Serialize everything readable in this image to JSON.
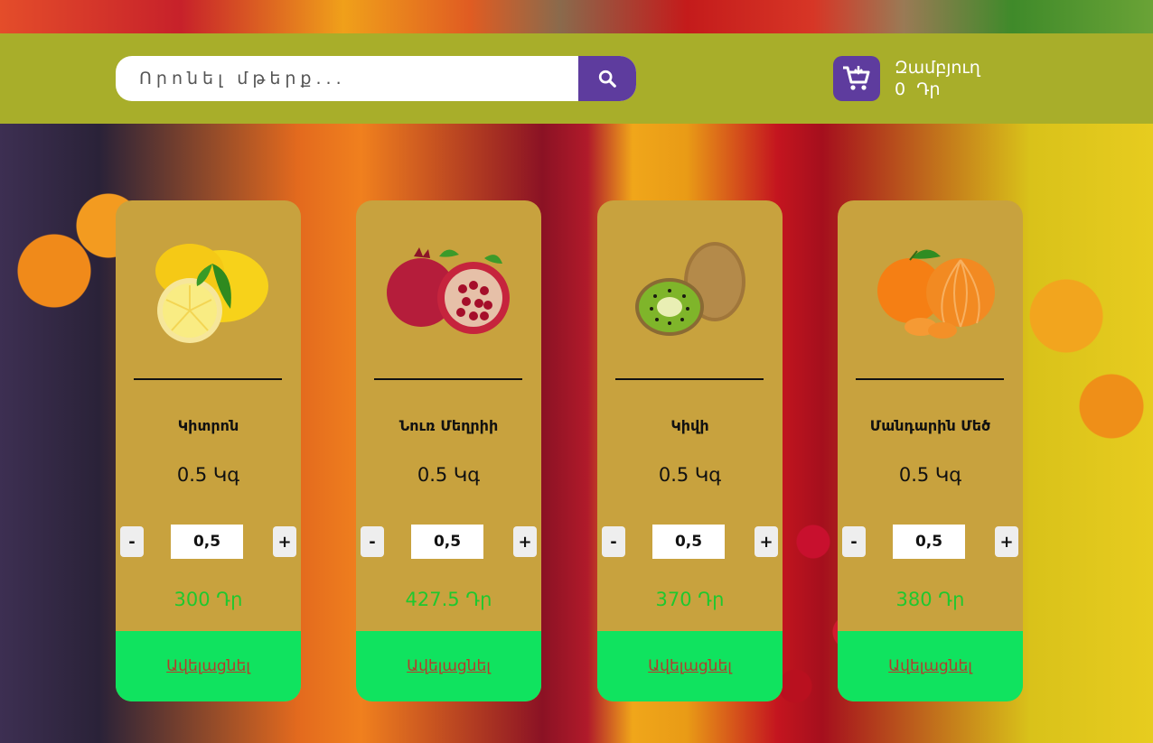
{
  "search": {
    "placeholder": "Որոնել մթերք..."
  },
  "cart": {
    "label": "Զամբյուղ",
    "total": "0",
    "currency": "Դր"
  },
  "products": [
    {
      "name": "Կիտրոն",
      "weight": "0.5 Կգ",
      "quantity": "0,5",
      "price": "300 Դր",
      "button": "Ավելացնել",
      "image": "lemon",
      "minus": "-",
      "plus": "+"
    },
    {
      "name": "Նուռ  Մեղրիի",
      "weight": "0.5 Կգ",
      "quantity": "0,5",
      "price": "427.5 Դր",
      "button": "Ավելացնել",
      "image": "pomegranate",
      "minus": "-",
      "plus": "+"
    },
    {
      "name": "Կիվի",
      "weight": "0.5 Կգ",
      "quantity": "0,5",
      "price": "370 Դր",
      "button": "Ավելացնել",
      "image": "kiwi",
      "minus": "-",
      "plus": "+"
    },
    {
      "name": "Մանդարին Մեծ",
      "weight": "0.5 Կգ",
      "quantity": "0,5",
      "price": "380 Դր",
      "button": "Ավելացնել",
      "image": "tangerine",
      "minus": "-",
      "plus": "+"
    }
  ],
  "colors": {
    "header": "#a8ae2a",
    "accent": "#5e3c9e",
    "card": "#c8a23e",
    "add_button": "#10e35f",
    "price": "#1fc82e"
  },
  "icons": {
    "search": "search-icon",
    "cart": "cart-icon"
  }
}
